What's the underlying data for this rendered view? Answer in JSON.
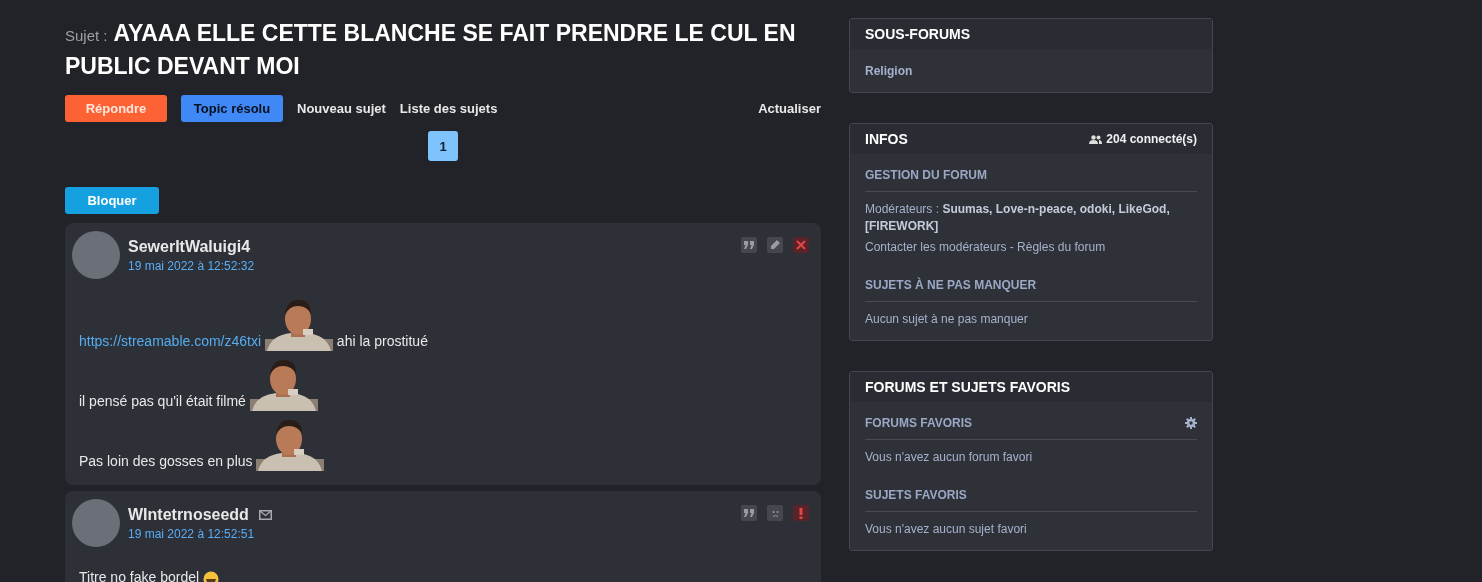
{
  "topic": {
    "prefix": "Sujet :",
    "title": "AYAAA ELLE CETTE BLANCHE SE FAIT PRENDRE LE CUL EN PUBLIC DEVANT MOI"
  },
  "actions": [
    {
      "label": "Répondre",
      "kind": "reply"
    },
    {
      "label": "Topic résolu",
      "kind": "resolved"
    },
    {
      "label": "Nouveau sujet",
      "kind": "link"
    },
    {
      "label": "Liste des sujets",
      "kind": "link"
    },
    {
      "label": "Actualiser",
      "kind": "refresh"
    }
  ],
  "pagination": [
    {
      "label": "1",
      "selected": true
    }
  ],
  "block_button": "Bloquer",
  "posts": [
    {
      "author": "SewerItWaluigi4",
      "date": "19 mai 2022 à 12:52:32",
      "message_icon": false,
      "tools": [
        {
          "kind": "quote"
        },
        {
          "kind": "edit"
        },
        {
          "kind": "delete"
        }
      ],
      "lines": [
        [
          {
            "kind": "link",
            "text": "https://streamable.com/z46txi"
          },
          {
            "kind": "sticker"
          },
          {
            "kind": "text",
            "text": "ahi la prostitué"
          }
        ],
        [
          {
            "kind": "text",
            "text": "il pensé pas qu'il était filmé"
          },
          {
            "kind": "sticker"
          }
        ],
        [
          {
            "kind": "text",
            "text": "Pas loin des gosses en plus"
          },
          {
            "kind": "sticker"
          }
        ]
      ]
    },
    {
      "author": "WIntetrnoseedd",
      "date": "19 mai 2022 à 12:52:51",
      "message_icon": true,
      "tools": [
        {
          "kind": "quote"
        },
        {
          "kind": "sad"
        },
        {
          "kind": "alert"
        }
      ],
      "lines": [
        [
          {
            "kind": "text",
            "text": "Titre no fake bordel"
          },
          {
            "kind": "emoji"
          }
        ]
      ]
    }
  ],
  "sidebar": [
    {
      "title": "SOUS-FORUMS",
      "sections": [
        {
          "items": [
            {
              "kind": "forum",
              "text": "Religion"
            }
          ]
        }
      ]
    },
    {
      "title": "INFOS",
      "online": "204 connecté(s)",
      "sections": [
        {
          "heading": "GESTION DU FORUM",
          "items": [
            {
              "kind": "rich",
              "text": "Modérateurs : **Suumas, Love-n-peace, odoki, LikeGod, [FIREWORK]**"
            },
            {
              "kind": "links",
              "links": [
                "Contacter les modérateurs",
                "Règles du forum"
              ],
              "separator": "-"
            }
          ]
        },
        {
          "heading": "SUJETS À NE PAS MANQUER",
          "items": [
            {
              "kind": "text",
              "text": "Aucun sujet à ne pas manquer"
            }
          ]
        }
      ]
    },
    {
      "title": "FORUMS ET SUJETS FAVORIS",
      "sections": [
        {
          "heading": "FORUMS FAVORIS",
          "settings": true,
          "items": [
            {
              "kind": "text",
              "text": "Vous n'avez aucun forum favori"
            }
          ]
        },
        {
          "heading": "SUJETS FAVORIS",
          "settings": false,
          "items": [
            {
              "kind": "text",
              "text": "Vous n'avez aucun sujet favori"
            }
          ]
        }
      ]
    }
  ]
}
